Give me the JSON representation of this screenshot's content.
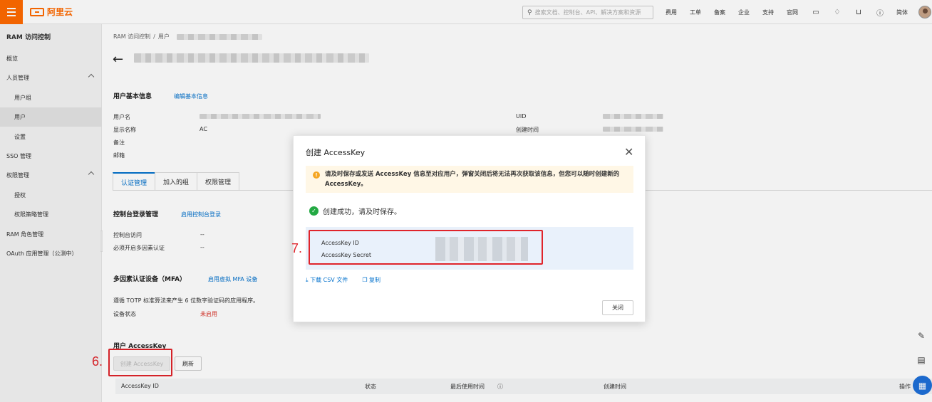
{
  "topbar": {
    "logo_text": "阿里云",
    "search_placeholder": "搜索文档、控制台、API、解决方案和资源",
    "nav": [
      "费用",
      "工单",
      "备案",
      "企业",
      "支持",
      "官网"
    ],
    "lang": "简体"
  },
  "sidebar": {
    "title": "RAM 访问控制",
    "items": [
      {
        "label": "概览",
        "level": "top"
      },
      {
        "label": "人员管理",
        "level": "top",
        "expanded": true
      },
      {
        "label": "用户组",
        "level": "sub"
      },
      {
        "label": "用户",
        "level": "sub",
        "active": true
      },
      {
        "label": "设置",
        "level": "sub"
      },
      {
        "label": "SSO 管理",
        "level": "top"
      },
      {
        "label": "权限管理",
        "level": "top",
        "expanded": true
      },
      {
        "label": "授权",
        "level": "sub"
      },
      {
        "label": "权限策略管理",
        "level": "sub"
      },
      {
        "label": "RAM 角色管理",
        "level": "top"
      },
      {
        "label": "OAuth 应用管理（公测中）",
        "level": "top"
      }
    ]
  },
  "breadcrumb": [
    "RAM 访问控制",
    "/",
    "用户"
  ],
  "basic_info": {
    "title": "用户基本信息",
    "edit_link": "编辑基本信息",
    "labels": {
      "username": "用户名",
      "display_name": "显示名称",
      "note": "备注",
      "email": "邮箱",
      "uid": "UID",
      "created": "创建时间"
    },
    "display_name_value": "AC"
  },
  "tabs": [
    "认证管理",
    "加入的组",
    "权限管理"
  ],
  "console_login": {
    "title": "控制台登录管理",
    "link": "启用控制台登录",
    "labels": [
      "控制台访问",
      "必须开启多因素认证"
    ],
    "values": [
      "--",
      "--"
    ]
  },
  "mfa": {
    "title": "多因素认证设备（MFA）",
    "link": "启用虚拟 MFA 设备",
    "desc": "遵循 TOTP 标准算法来产生 6 位数字验证码的应用程序。",
    "status_label": "设备状态",
    "status_value": "未启用"
  },
  "access_key": {
    "title": "用户 AccessKey",
    "create_btn": "创建 AccessKey",
    "refresh_btn": "刷新",
    "columns": [
      "AccessKey ID",
      "状态",
      "最后使用时间",
      "创建时间",
      "操作"
    ]
  },
  "annotations": {
    "step6": "6.",
    "step7": "7."
  },
  "modal": {
    "title": "创建 AccessKey",
    "warning": "请及时保存或发送 AccessKey 信息至对应用户，弹窗关闭后将无法再次获取该信息，但您可以随时创建新的 AccessKey。",
    "success": "创建成功，请及时保存。",
    "key_id_label": "AccessKey ID",
    "key_secret_label": "AccessKey Secret",
    "download_link": "下载 CSV 文件",
    "copy_link": "复制",
    "close_btn": "关闭"
  },
  "colors": {
    "brand": "#ff6a00",
    "link": "#0070cc",
    "annotation": "#e0242b",
    "success": "#23a943",
    "warning": "#f5a623"
  }
}
